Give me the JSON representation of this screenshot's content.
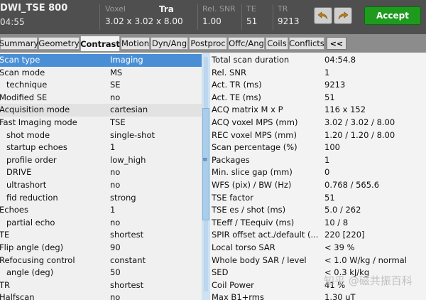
{
  "header": {
    "protocol": "DWI_TSE 800",
    "duration": "04:55",
    "voxel_label": "Voxel",
    "voxel_value": "3.02 x 3.02 x 8.00",
    "orientation": "Tra",
    "snr_label": "Rel. SNR",
    "snr_value": "1.00",
    "te_label": "TE",
    "te_value": "51",
    "tr_label": "TR",
    "tr_value": "9213",
    "accept_label": "Accept"
  },
  "tabs": [
    {
      "label": "Summary"
    },
    {
      "label": "Geometry"
    },
    {
      "label": "Contrast",
      "active": true
    },
    {
      "label": "Motion"
    },
    {
      "label": "Dyn/Ang"
    },
    {
      "label": "Postproc"
    },
    {
      "label": "Offc/Ang"
    },
    {
      "label": "Coils"
    },
    {
      "label": "Conflicts"
    }
  ],
  "collapse_label": "<<",
  "parameters": [
    {
      "name": "Scan type",
      "value": "Imaging",
      "indent": 0,
      "selected": true
    },
    {
      "name": "Scan mode",
      "value": "MS",
      "indent": 0
    },
    {
      "name": "technique",
      "value": "SE",
      "indent": 1
    },
    {
      "name": "Modified SE",
      "value": "no",
      "indent": 0
    },
    {
      "name": "Acquisition mode",
      "value": "cartesian",
      "indent": 0
    },
    {
      "name": "Fast Imaging mode",
      "value": "TSE",
      "indent": 0
    },
    {
      "name": "shot mode",
      "value": "single-shot",
      "indent": 1
    },
    {
      "name": "startup echoes",
      "value": "1",
      "indent": 1
    },
    {
      "name": "profile order",
      "value": "low_high",
      "indent": 1
    },
    {
      "name": "DRIVE",
      "value": "no",
      "indent": 1
    },
    {
      "name": "ultrashort",
      "value": "no",
      "indent": 1
    },
    {
      "name": "fid reduction",
      "value": "strong",
      "indent": 1
    },
    {
      "name": "Echoes",
      "value": "1",
      "indent": 0
    },
    {
      "name": "partial echo",
      "value": "no",
      "indent": 1
    },
    {
      "name": "TE",
      "value": "shortest",
      "indent": 0
    },
    {
      "name": "Flip angle (deg)",
      "value": "90",
      "indent": 0
    },
    {
      "name": "Refocusing control",
      "value": "constant",
      "indent": 0
    },
    {
      "name": "angle (deg)",
      "value": "50",
      "indent": 1
    },
    {
      "name": "TR",
      "value": "shortest",
      "indent": 0
    },
    {
      "name": "Halfscan",
      "value": "no",
      "indent": 0
    }
  ],
  "info": [
    {
      "name": "Total scan duration",
      "value": "04:54.8"
    },
    {
      "name": "Rel. SNR",
      "value": "1"
    },
    {
      "name": "Act. TR (ms)",
      "value": "9213"
    },
    {
      "name": "Act. TE (ms)",
      "value": "51"
    },
    {
      "name": "ACQ matrix M x P",
      "value": "116 x 152"
    },
    {
      "name": "ACQ voxel MPS (mm)",
      "value": "3.02 / 3.02 / 8.00"
    },
    {
      "name": "REC voxel MPS (mm)",
      "value": "1.20 / 1.20 / 8.00"
    },
    {
      "name": "Scan percentage (%)",
      "value": "100"
    },
    {
      "name": "Packages",
      "value": "1"
    },
    {
      "name": "Min. slice gap (mm)",
      "value": "0"
    },
    {
      "name": "WFS (pix) / BW (Hz)",
      "value": "0.768 / 565.6"
    },
    {
      "name": "TSE factor",
      "value": "51"
    },
    {
      "name": "TSE es / shot (ms)",
      "value": "5.0 / 262"
    },
    {
      "name": "TEeff / TEequiv (ms)",
      "value": "10 / 8"
    },
    {
      "name": "SPIR offset act./default (...",
      "value": "220 [220]"
    },
    {
      "name": "Local torso SAR",
      "value": "< 39 %"
    },
    {
      "name": "Whole body SAR / level",
      "value": "< 1.0 W/kg / normal"
    },
    {
      "name": "SED",
      "value": "< 0.3 kJ/kg"
    },
    {
      "name": "Coil Power",
      "value": "41 %"
    },
    {
      "name": "Max B1+rms",
      "value": "1.30 uT"
    }
  ],
  "watermark": "知乎 @磁共振百科",
  "icons": {
    "back": "undo-arrow-icon",
    "forward": "redo-arrow-icon",
    "splitter": "splitter-grip-icon"
  },
  "colors": {
    "selected_row": "#4a8fd6",
    "accept_button": "#1e9a1e",
    "header_bg": "#4f4f4f"
  }
}
